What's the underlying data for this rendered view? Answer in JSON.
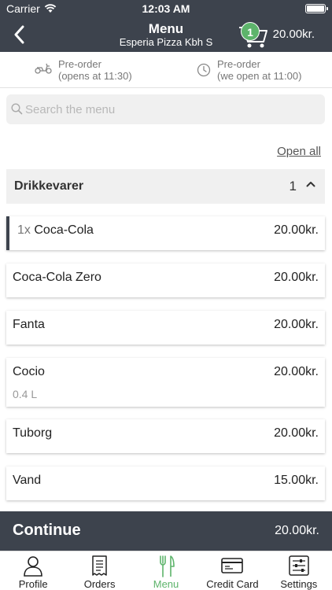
{
  "status": {
    "carrier": "Carrier",
    "time": "12:03 AM"
  },
  "navbar": {
    "title": "Menu",
    "subtitle": "Esperia Pizza Kbh S",
    "cart_count": "1",
    "cart_total": "20.00kr."
  },
  "preorder": {
    "delivery": {
      "line1": "Pre-order",
      "line2": "(opens at 11:30)",
      "icon": "scooter-icon"
    },
    "pickup": {
      "line1": "Pre-order",
      "line2": "(we open at 11:00)",
      "icon": "clock-icon"
    }
  },
  "search": {
    "placeholder": "Search the menu",
    "value": ""
  },
  "open_all": "Open all",
  "category": {
    "name": "Drikkevarer",
    "count": "1"
  },
  "items": [
    {
      "qty": "1x",
      "name": "Coca-Cola",
      "price": "20.00kr.",
      "sub": ""
    },
    {
      "qty": "",
      "name": "Coca-Cola Zero",
      "price": "20.00kr.",
      "sub": ""
    },
    {
      "qty": "",
      "name": "Fanta",
      "price": "20.00kr.",
      "sub": ""
    },
    {
      "qty": "",
      "name": "Cocio",
      "price": "20.00kr.",
      "sub": "0.4 L"
    },
    {
      "qty": "",
      "name": "Tuborg",
      "price": "20.00kr.",
      "sub": ""
    },
    {
      "qty": "",
      "name": "Vand",
      "price": "15.00kr.",
      "sub": ""
    }
  ],
  "continue": {
    "label": "Continue",
    "total": "20.00kr."
  },
  "tabs": [
    {
      "label": "Profile",
      "icon": "person-icon"
    },
    {
      "label": "Orders",
      "icon": "receipt-icon"
    },
    {
      "label": "Menu",
      "icon": "fork-knife-icon"
    },
    {
      "label": "Credit Card",
      "icon": "credit-card-icon"
    },
    {
      "label": "Settings",
      "icon": "sliders-icon"
    }
  ],
  "colors": {
    "header": "#3d434d",
    "accent": "#5db46b"
  }
}
